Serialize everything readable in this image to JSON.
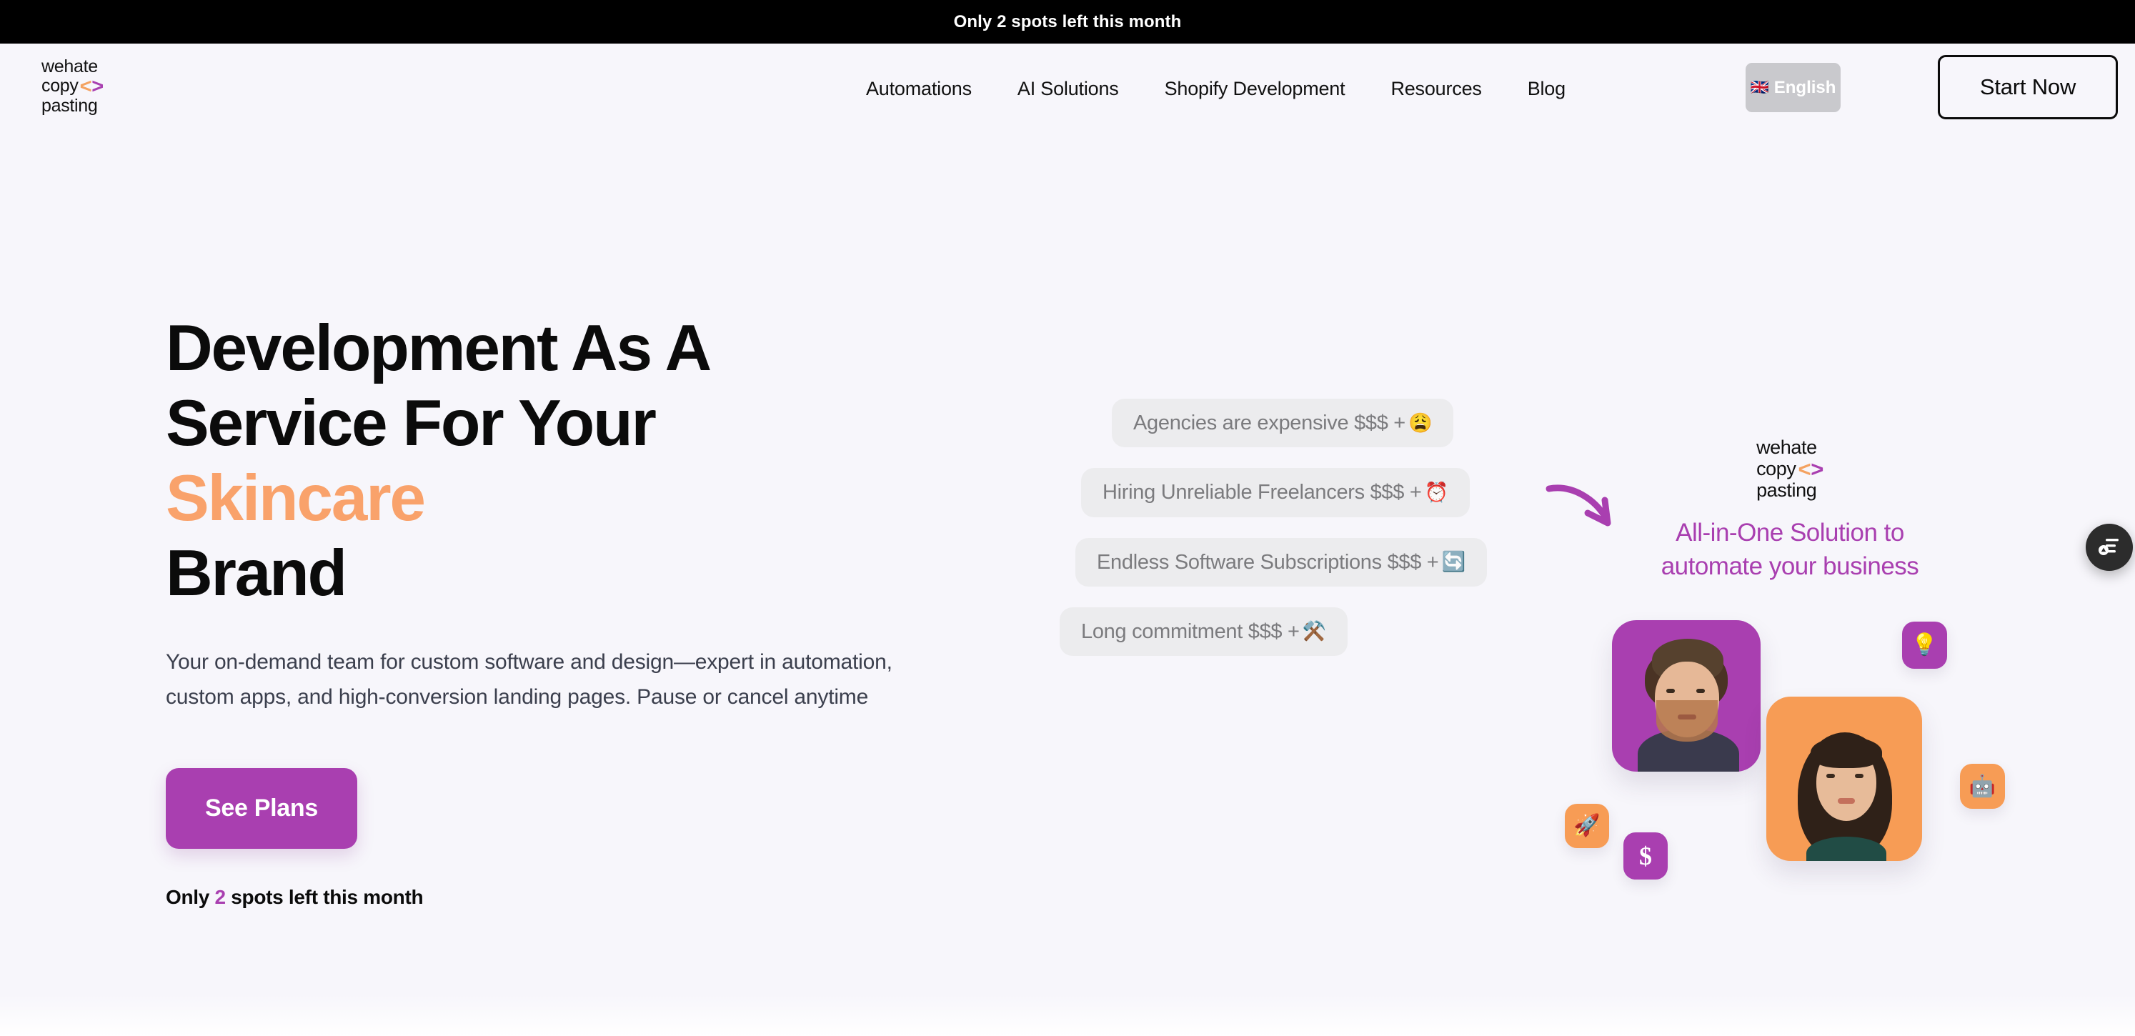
{
  "announcement": {
    "text": "Only 2 spots left this month"
  },
  "logo": {
    "line1": "wehate",
    "line2": "copy",
    "lt": "<",
    "gt": ">",
    "line3": "pasting"
  },
  "nav": {
    "items": [
      {
        "label": "Automations"
      },
      {
        "label": "AI Solutions"
      },
      {
        "label": "Shopify Development"
      },
      {
        "label": "Resources"
      },
      {
        "label": "Blog"
      }
    ],
    "language": {
      "label": "English",
      "flag": "🇬🇧"
    },
    "cta": {
      "label": "Start Now"
    }
  },
  "hero": {
    "headline_line1": "Development As A",
    "headline_line2": "Service For Your",
    "headline_accent": "Skincare",
    "headline_line4": "Brand",
    "subheading": "Your on-demand team for custom software and design—expert in automation, custom apps, and high-conversion landing pages. Pause or cancel anytime",
    "cta_label": "See Plans",
    "spots_prefix": "Only ",
    "spots_number": "2",
    "spots_suffix": " spots left this month"
  },
  "pain_points": [
    {
      "text": "Agencies are expensive $$$ +",
      "emoji": "😩",
      "emoji_name": "weary-face-emoji"
    },
    {
      "text": "Hiring Unreliable Freelancers $$$ +",
      "emoji": "⏰",
      "emoji_name": "alarm-clock-emoji"
    },
    {
      "text": "Endless Software Subscriptions $$$ +",
      "emoji": "🔄",
      "emoji_name": "refresh-emoji"
    },
    {
      "text": "Long commitment $$$ +",
      "emoji": "⚒️",
      "emoji_name": "hammer-and-pick-emoji"
    }
  ],
  "brand_panel": {
    "logo": {
      "line1": "wehate",
      "line2": "copy",
      "lt": "<",
      "gt": ">",
      "line3": "pasting"
    },
    "tagline_line1": "All-in-One Solution to",
    "tagline_line2": "automate your business"
  },
  "collage": {
    "badges": [
      {
        "name": "lightbulb-badge",
        "emoji": "💡"
      },
      {
        "name": "robot-badge",
        "emoji": "🤖"
      },
      {
        "name": "rocket-badge",
        "emoji": "🚀"
      },
      {
        "name": "dollar-badge",
        "emoji": "$"
      }
    ]
  },
  "colors": {
    "background": "#f7f6fb",
    "purple": "#a93fb0",
    "orange": "#f79c55",
    "headline_accent": "#f9a26b",
    "chip_bg": "#ececee",
    "chip_text": "#7b7b7e",
    "black": "#0b0b0b"
  }
}
